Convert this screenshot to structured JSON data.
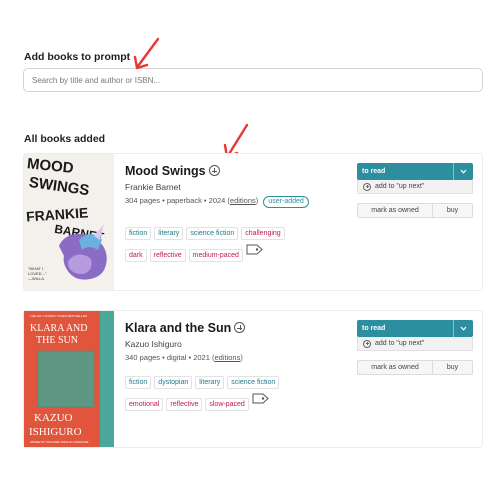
{
  "add_section": {
    "title": "Add books to prompt",
    "search_placeholder": "Search by title and author or ISBN..."
  },
  "list_section": {
    "title": "All books added"
  },
  "books": [
    {
      "title": "Mood Swings",
      "author": "Frankie Barnet",
      "meta_text": "304 pages • paperback • 2024 (",
      "editions_label": "editions",
      "meta_close": ")",
      "badge": "user-added",
      "mood_tags": [
        "fiction",
        "literary",
        "science fiction"
      ],
      "mood_tags_2": [
        "dark",
        "reflective"
      ],
      "emphasis_tag": "challenging",
      "pace_tag": "medium-paced",
      "cover": {
        "lines": [
          "MOOD",
          "SWINGS",
          "FRANKIE",
          "BARNET"
        ],
        "blurb": "\"What I loved\nwhat it took\nbreathe\"",
        "accent": "#8b6cc4"
      },
      "to_read_label": "to read",
      "up_next_label": "add to \"up next\"",
      "owned_label": "mark as owned",
      "buy_label": "buy"
    },
    {
      "title": "Klara and the Sun",
      "author": "Kazuo Ishiguro",
      "meta_text": "340 pages • digital • 2021 (",
      "editions_label": "editions",
      "meta_close": ")",
      "mood_tags": [
        "fiction",
        "dystopian",
        "literary",
        "science fiction"
      ],
      "mood_tags_2": [],
      "emphasis_tags": [
        "emotional",
        "reflective",
        "slow-paced"
      ],
      "cover": {
        "top_line": "THE NO.1 SUNDAY TIMES BESTSELLER",
        "title_lines": [
          "KLARA AND",
          "THE SUN"
        ],
        "author_lines": [
          "KAZUO",
          "ISHIGURO"
        ],
        "footer": "WINNER OF THE NOBEL PRIZE IN LITERATURE",
        "bg": "#e0553b",
        "spine": "#4aa89a"
      },
      "to_read_label": "to read",
      "up_next_label": "add to \"up next\"",
      "owned_label": "mark as owned",
      "buy_label": "buy"
    }
  ],
  "colors": {
    "accent": "#2c8e9e",
    "pace": "#c2185b",
    "arrow": "#e53935"
  }
}
